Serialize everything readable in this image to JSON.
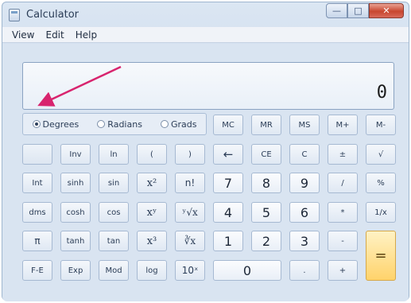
{
  "window": {
    "title": "Calculator",
    "caption_buttons": {
      "minimize": "—",
      "maximize": "□",
      "close": "✕"
    }
  },
  "menu": [
    "View",
    "Edit",
    "Help"
  ],
  "display": {
    "value": "0"
  },
  "angle_modes": [
    {
      "label": "Degrees",
      "selected": true
    },
    {
      "label": "Radians",
      "selected": false
    },
    {
      "label": "Grads",
      "selected": false
    }
  ],
  "keys": {
    "mc": "MC",
    "mr": "MR",
    "ms": "MS",
    "mplus": "M+",
    "mminus": "M-",
    "inv": "Inv",
    "ln": "ln",
    "lparen": "(",
    "rparen": ")",
    "backspace": "←",
    "ce": "CE",
    "c": "C",
    "plusminus": "±",
    "sqrt": "√",
    "int": "Int",
    "sinh": "sinh",
    "sin": "sin",
    "x2": "x²",
    "fact": "n!",
    "seven": "7",
    "eight": "8",
    "nine": "9",
    "divide": "/",
    "percent": "%",
    "dms": "dms",
    "cosh": "cosh",
    "cos": "cos",
    "xy": "xʸ",
    "yroot": "ʸ√x",
    "four": "4",
    "five": "5",
    "six": "6",
    "multiply": "*",
    "recip": "1/x",
    "pi": "π",
    "tanh": "tanh",
    "tan": "tan",
    "x3": "x³",
    "cbrt": "∛x",
    "one": "1",
    "two": "2",
    "three": "3",
    "minus": "-",
    "fe": "F-E",
    "exp": "Exp",
    "mod": "Mod",
    "log": "log",
    "tenx": "10ˣ",
    "zero": "0",
    "decimal": ".",
    "plus": "+",
    "equals": "="
  },
  "colors": {
    "annotation_arrow": "#d8246e",
    "equals_key": "#ffd36b"
  }
}
